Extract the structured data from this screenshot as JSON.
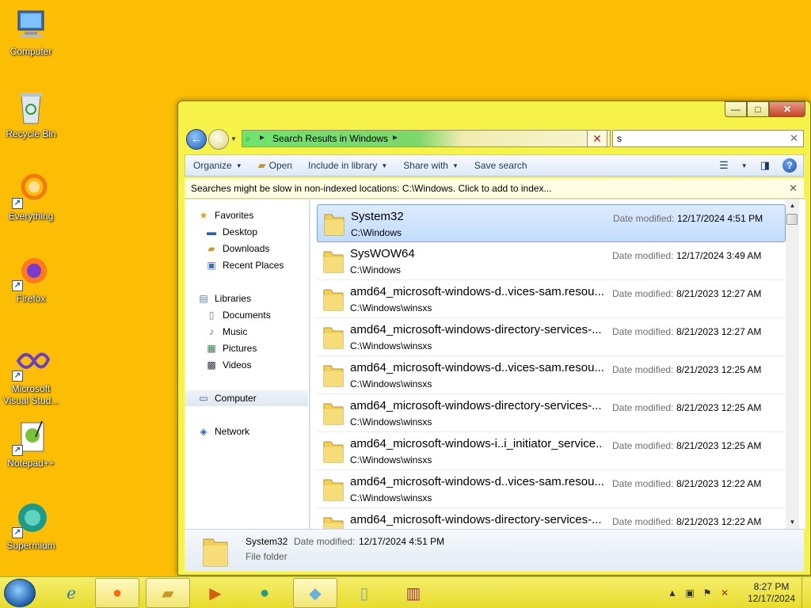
{
  "desktop": {
    "icons": [
      {
        "label": "Computer"
      },
      {
        "label": "Recycle Bin"
      },
      {
        "label": "Everything"
      },
      {
        "label": "Firefox"
      },
      {
        "label": "Microsoft Visual Stud..."
      },
      {
        "label": "Notepad++"
      },
      {
        "label": "Supermium"
      }
    ]
  },
  "window": {
    "title_buttons": {
      "minimize": "—",
      "maximize": "□",
      "close": "✕"
    },
    "address": {
      "text": "Search Results in Windows"
    },
    "search": {
      "value": "s"
    },
    "commands": {
      "organize": "Organize",
      "open": "Open",
      "include_in_library": "Include in library",
      "share_with": "Share with",
      "save_search": "Save search"
    },
    "infobar": {
      "text": "Searches might be slow in non-indexed locations: C:\\Windows. Click to add to index..."
    },
    "nav": {
      "favorites": "Favorites",
      "desktop": "Desktop",
      "downloads": "Downloads",
      "recent_places": "Recent Places",
      "libraries": "Libraries",
      "documents": "Documents",
      "music": "Music",
      "pictures": "Pictures",
      "videos": "Videos",
      "computer": "Computer",
      "network": "Network"
    },
    "files": [
      {
        "name": "System32",
        "path": "C:\\Windows",
        "date_label": "Date modified:",
        "date": "12/17/2024 4:51 PM"
      },
      {
        "name": "SysWOW64",
        "path": "C:\\Windows",
        "date_label": "Date modified:",
        "date": "12/17/2024 3:49 AM"
      },
      {
        "name": "amd64_microsoft-windows-d..vices-sam.resou...",
        "path": "C:\\Windows\\winsxs",
        "date_label": "Date modified:",
        "date": "8/21/2023 12:27 AM"
      },
      {
        "name": "amd64_microsoft-windows-directory-services-...",
        "path": "C:\\Windows\\winsxs",
        "date_label": "Date modified:",
        "date": "8/21/2023 12:27 AM"
      },
      {
        "name": "amd64_microsoft-windows-d..vices-sam.resou...",
        "path": "C:\\Windows\\winsxs",
        "date_label": "Date modified:",
        "date": "8/21/2023 12:25 AM"
      },
      {
        "name": "amd64_microsoft-windows-directory-services-...",
        "path": "C:\\Windows\\winsxs",
        "date_label": "Date modified:",
        "date": "8/21/2023 12:25 AM"
      },
      {
        "name": "amd64_microsoft-windows-i..i_initiator_service...",
        "path": "C:\\Windows\\winsxs",
        "date_label": "Date modified:",
        "date": "8/21/2023 12:25 AM"
      },
      {
        "name": "amd64_microsoft-windows-d..vices-sam.resou...",
        "path": "C:\\Windows\\winsxs",
        "date_label": "Date modified:",
        "date": "8/21/2023 12:22 AM"
      },
      {
        "name": "amd64_microsoft-windows-directory-services-...",
        "path": "",
        "date_label": "Date modified:",
        "date": "8/21/2023 12:22 AM"
      }
    ],
    "details": {
      "name": "System32",
      "date_label": "Date modified:",
      "date": "12/17/2024 4:51 PM",
      "type": "File folder"
    }
  },
  "taskbar": {
    "clock_time": "8:27 PM",
    "clock_date": "12/17/2024"
  },
  "colors": {
    "desktop_bg": "#FCBE05",
    "window_frame": "#F7F248",
    "selection": "#C1DCFC",
    "highlight_match": "#FFF59A"
  }
}
